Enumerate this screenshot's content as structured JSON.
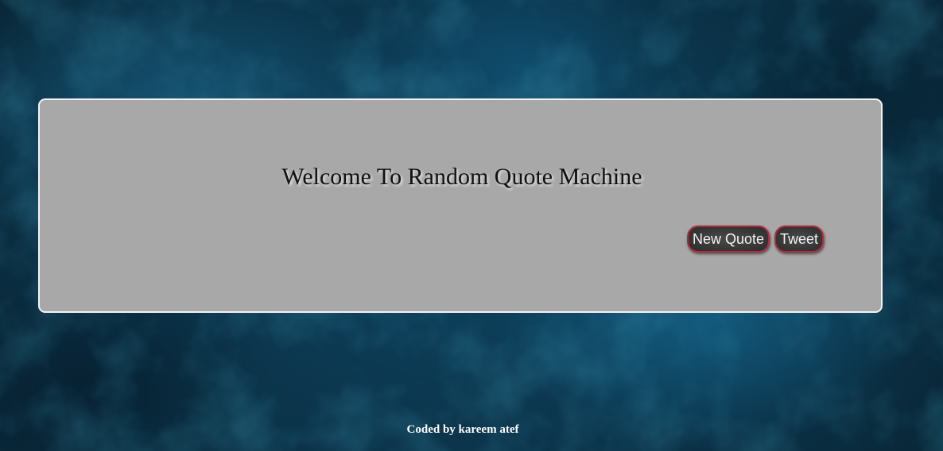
{
  "quote": {
    "text": "Welcome To Random Quote Machine"
  },
  "buttons": {
    "new_quote_label": "New Quote",
    "tweet_label": "Tweet"
  },
  "footer": {
    "credit": "Coded by kareem atef"
  },
  "colors": {
    "background": "#0e3d57",
    "card": "#a8a8a8",
    "button_fill": "#3a3a3a",
    "button_border": "#b02a3a",
    "footer_text": "#ffffff"
  }
}
